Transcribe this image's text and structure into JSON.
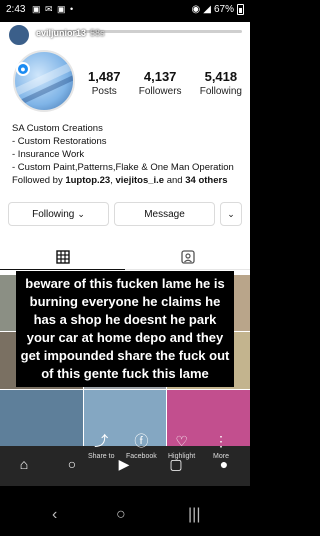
{
  "status_bar": {
    "time": "2:43",
    "left_icons": "▣ ✉ ▣ •",
    "battery_pct": "67%",
    "signal": "◢",
    "wifi": "◉"
  },
  "story": {
    "username": "eviljunior13",
    "age": "58s",
    "progress": 0.2
  },
  "profile": {
    "stats": [
      {
        "value": "1,487",
        "label": "Posts"
      },
      {
        "value": "4,137",
        "label": "Followers"
      },
      {
        "value": "5,418",
        "label": "Following"
      }
    ],
    "bio": {
      "name": "SA Custom Creations",
      "lines": [
        "- Custom Restorations",
        "- Insurance Work",
        "- Custom Paint,Patterns,Flake & One Man Operation"
      ],
      "followed_prefix": "Followed by ",
      "followed_user1": "1uptop.23",
      "followed_sep": ", ",
      "followed_user2": "viejitos_i.e",
      "followed_and": " and ",
      "followed_others": "34 others"
    },
    "buttons": {
      "following": "Following",
      "following_chevron": "⌄",
      "message": "Message",
      "more": "⌄"
    }
  },
  "caption": "beware of this fucken lame he is burning everyone he claims he has a shop he doesnt he park your car at home depo and they get impounded share the fuck out of this gente fuck this lame",
  "actions": [
    {
      "label": "Share to",
      "icon": "share-icon"
    },
    {
      "label": "Facebook",
      "icon": "facebook-icon"
    },
    {
      "label": "Highlight",
      "icon": "highlight-icon"
    },
    {
      "label": "More",
      "icon": "more-icon"
    }
  ],
  "colors": {
    "accent": "#1b8bf2",
    "caption_bg": "#000000",
    "caption_text": "#ffffff"
  }
}
